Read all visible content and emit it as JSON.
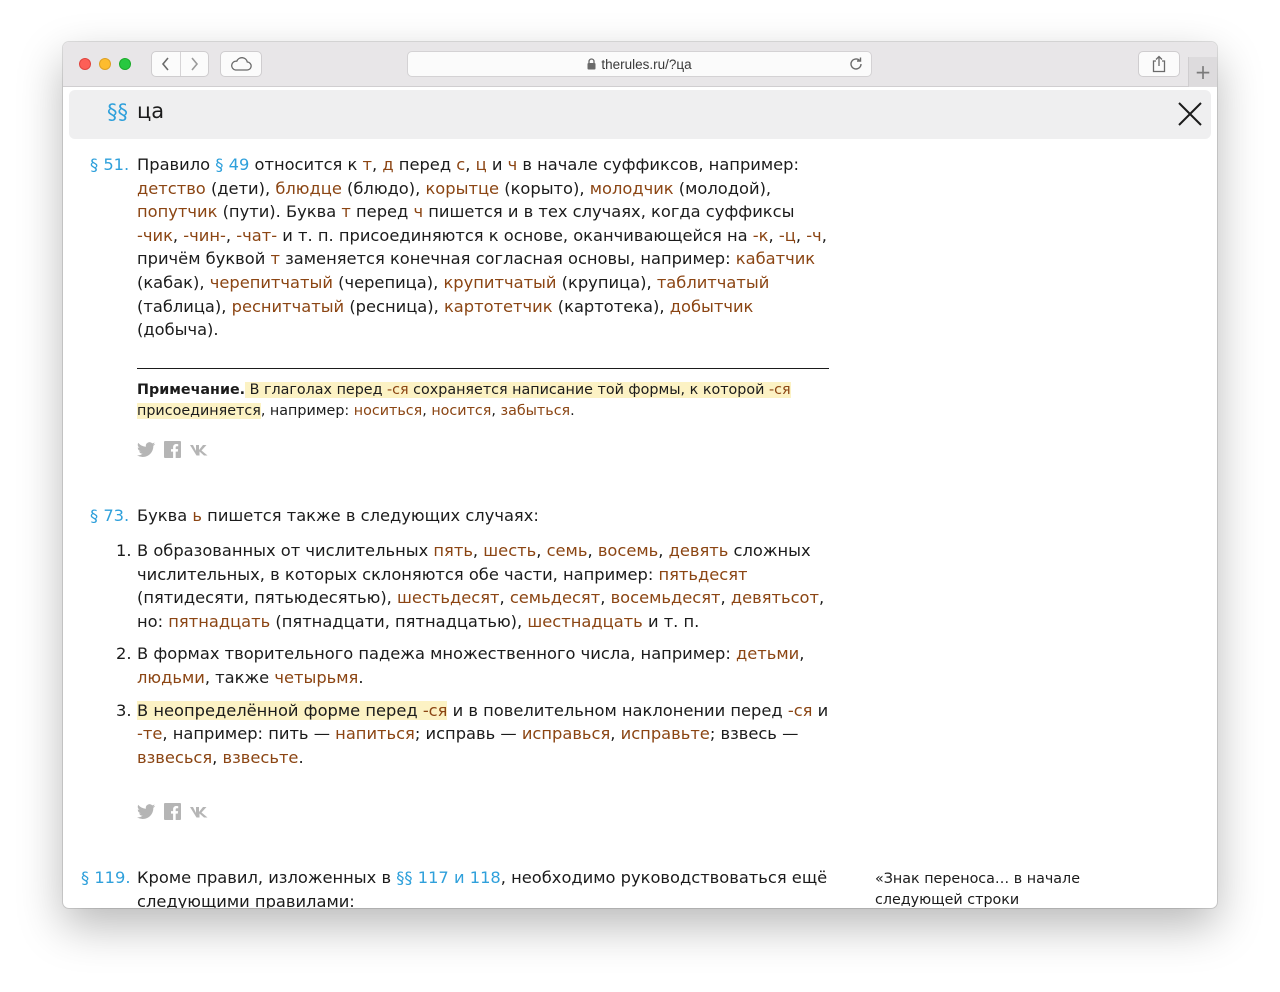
{
  "browser": {
    "url": "therules.ru/?ца",
    "new_tab_label": "+"
  },
  "search": {
    "mark": "§§",
    "query": "ца"
  },
  "p51": {
    "num": "§ 51.",
    "t1": "Правило ",
    "link1": "§ 49",
    "t2": " относится к ",
    "e_t": "т",
    "t3": ", ",
    "e_d": "д",
    "t4": " перед ",
    "e_s": "с",
    "t5": ", ",
    "e_ts": "ц",
    "t6": " и ",
    "e_ch": "ч",
    "t7": " в начале суффиксов, например: ",
    "w1": "детство",
    "w1g": " (дети), ",
    "w2": "блюдце",
    "w2g": " (блюдо), ",
    "w3": "корытце",
    "w3g": " (корыто), ",
    "w4": "молодчик",
    "w4g": " (молодой), ",
    "w5": "попутчик",
    "w5g": " (пути). Буква ",
    "e_t2": "т",
    "t8": " перед ",
    "e_ch2": "ч",
    "t9": " пишется и в тех случаях, когда суффиксы ",
    "s1": "-чик",
    "t10": ", ",
    "s2": "-чин-",
    "t11": ", ",
    "s3": "-чат-",
    "t12": " и т. п. присоединяются к основе, оканчивающейся на ",
    "s4": "-к",
    "t13": ", ",
    "s5": "-ц",
    "t14": ", ",
    "s6": "-ч",
    "t15": ", причём буквой ",
    "e_t3": "т",
    "t16": " заменяется конечная согласная основы, например: ",
    "w6": "кабатчик",
    "w6g": " (кабак), ",
    "w7": "черепитчатый",
    "w7g": " (черепица), ",
    "w8": "крупитчатый",
    "w8g": " (крупица), ",
    "w9": "таблитчатый",
    "w9g": " (таблица), ",
    "w10": "реснитчатый",
    "w10g": " (ресница), ",
    "w11": "картотетчик",
    "w11g": " (картотека), ",
    "w12": "добытчик",
    "w12g": " (добыча).",
    "note_label": "Примечание.",
    "note_h1": " В глаголах перед ",
    "note_s1": "-ся",
    "note_h2": " сохраняется написание той формы, к которой ",
    "note_s2": "-ся",
    "note_h3": " присоединяется",
    "note_t1": ", например: ",
    "note_w1": "носиться",
    "note_t2": ", ",
    "note_w2": "носится",
    "note_t3": ", ",
    "note_w3": "забыться",
    "note_t4": "."
  },
  "p73": {
    "num": "§ 73.",
    "t1": "Буква ",
    "e1": "ь",
    "t2": " пишется также в следующих случаях:",
    "i1": {
      "num": "1.",
      "t1": "В образованных от числительных ",
      "n1": "пять",
      "c1": ", ",
      "n2": "шесть",
      "c2": ", ",
      "n3": "семь",
      "c3": ", ",
      "n4": "восемь",
      "c4": ", ",
      "n5": "девять",
      "t2": " сложных числительных, в которых склоняются обе части, например: ",
      "w1": "пятьдесят",
      "w1g": " (пятидесяти, пятьюдесятью), ",
      "w2": "шестьдесят",
      "c5": ", ",
      "w3": "семьдесят",
      "c6": ", ",
      "w4": "восемьдесят",
      "c7": ", ",
      "w5": "девятьсот",
      "t3": ", но: ",
      "w6": "пятнадцать",
      "w6g": " (пятнадцати, пятнадцатью), ",
      "w7": "шестнадцать",
      "t4": " и т. п."
    },
    "i2": {
      "num": "2.",
      "t1": "В формах творительного падежа множественного числа, например: ",
      "w1": "детьми",
      "c1": ", ",
      "w2": "людьми",
      "t2": ", также ",
      "w3": "четырьмя",
      "t3": "."
    },
    "i3": {
      "num": "3.",
      "h1": "В неопределённой форме перед ",
      "hs": "-ся",
      "t1": " и в повелительном наклонении перед ",
      "s1": "-ся",
      "t2": " и ",
      "s2": "-те",
      "t3": ", например: пить — ",
      "w1": "напиться",
      "t4": "; исправь — ",
      "w2": "исправься",
      "c1": ", ",
      "w3": "исправьте",
      "t5": "; взвесь — ",
      "w4": "взвесься",
      "c2": ", ",
      "w5": "взвесьте",
      "t6": "."
    }
  },
  "p119": {
    "num": "§ 119.",
    "t1": "Кроме правил, изложенных в ",
    "link1": "§§ 117 и 118",
    "t2": ", необходимо руководствоваться ещё следующими правилами:",
    "quote": "«Знак переноса… в начале следующей строки"
  }
}
